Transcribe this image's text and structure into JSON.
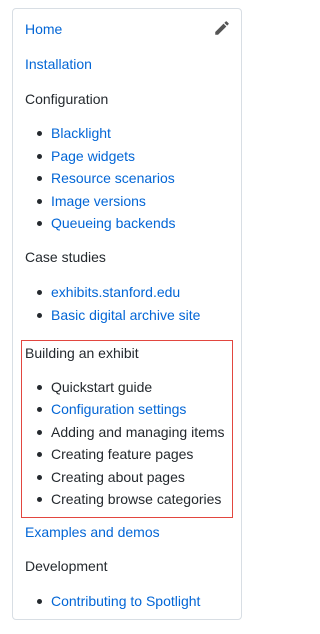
{
  "nav": {
    "home": "Home",
    "installation": "Installation",
    "configuration": {
      "title": "Configuration",
      "items": [
        "Blacklight",
        "Page widgets",
        "Resource scenarios",
        "Image versions",
        "Queueing backends"
      ]
    },
    "case_studies": {
      "title": "Case studies",
      "items": [
        "exhibits.stanford.edu",
        "Basic digital archive site"
      ]
    },
    "building_exhibit": {
      "title": "Building an exhibit",
      "items": [
        "Quickstart guide",
        "Configuration settings",
        "Adding and managing items",
        "Creating feature pages",
        "Creating about pages",
        "Creating browse categories"
      ]
    },
    "examples": "Examples and demos",
    "development": {
      "title": "Development",
      "items": [
        "Contributing to Spotlight"
      ]
    }
  },
  "colors": {
    "link": "#0366d6",
    "highlight_border": "#e2463f"
  },
  "icons": {
    "edit": "pencil-icon"
  }
}
